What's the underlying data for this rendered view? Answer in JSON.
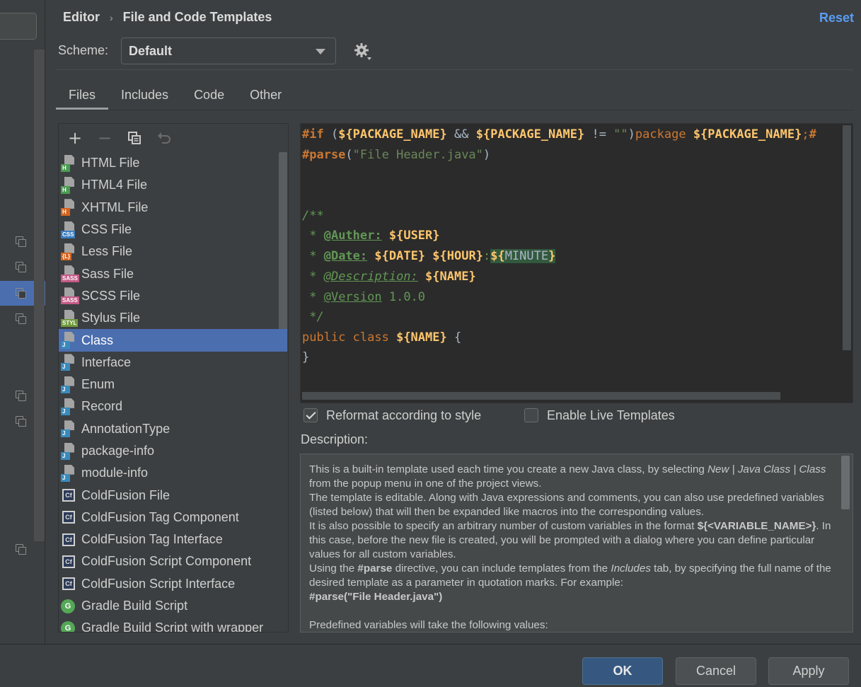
{
  "header": {
    "breadcrumb_parent": "Editor",
    "breadcrumb_separator": "›",
    "breadcrumb_current": "File and Code Templates",
    "reset_label": "Reset"
  },
  "scheme": {
    "label": "Scheme:",
    "value": "Default"
  },
  "tabs": [
    {
      "label": "Files",
      "active": true
    },
    {
      "label": "Includes",
      "active": false
    },
    {
      "label": "Code",
      "active": false
    },
    {
      "label": "Other",
      "active": false
    }
  ],
  "toolbar": {
    "add": "+",
    "remove": "−",
    "copy_icon": "copy-icon",
    "reset_icon": "undo-icon"
  },
  "templates": [
    {
      "label": "HTML File",
      "icon": "H",
      "color": "#4a9c52"
    },
    {
      "label": "HTML4 File",
      "icon": "H",
      "color": "#4a9c52"
    },
    {
      "label": "XHTML File",
      "icon": "H",
      "color": "#d6641f"
    },
    {
      "label": "CSS File",
      "icon": "CSS",
      "color": "#3b7dc0"
    },
    {
      "label": "Less File",
      "icon": "{L}",
      "color": "#d6641f"
    },
    {
      "label": "Sass File",
      "icon": "SASS",
      "color": "#c45a86"
    },
    {
      "label": "SCSS File",
      "icon": "SASS",
      "color": "#c45a86"
    },
    {
      "label": "Stylus File",
      "icon": "STYL",
      "color": "#6f9b3b"
    },
    {
      "label": "Class",
      "icon": "J",
      "color": "#3a8bbd",
      "selected": true
    },
    {
      "label": "Interface",
      "icon": "J",
      "color": "#3a8bbd"
    },
    {
      "label": "Enum",
      "icon": "J",
      "color": "#3a8bbd"
    },
    {
      "label": "Record",
      "icon": "J",
      "color": "#3a8bbd"
    },
    {
      "label": "AnnotationType",
      "icon": "J",
      "color": "#3a8bbd"
    },
    {
      "label": "package-info",
      "icon": "J",
      "color": "#3a8bbd"
    },
    {
      "label": "module-info",
      "icon": "J",
      "color": "#3a8bbd"
    },
    {
      "label": "ColdFusion File",
      "icon": "Cf",
      "color": "#2d3b57"
    },
    {
      "label": "ColdFusion Tag Component",
      "icon": "Cf",
      "color": "#2d3b57"
    },
    {
      "label": "ColdFusion Tag Interface",
      "icon": "Cf",
      "color": "#2d3b57"
    },
    {
      "label": "ColdFusion Script Component",
      "icon": "Cf",
      "color": "#2d3b57"
    },
    {
      "label": "ColdFusion Script Interface",
      "icon": "Cf",
      "color": "#2d3b57"
    },
    {
      "label": "Gradle Build Script",
      "icon": "G",
      "color": "#54a857"
    },
    {
      "label": "Gradle Build Script with wrapper",
      "icon": "G",
      "color": "#54a857"
    }
  ],
  "code": {
    "l1_if": "#if",
    "l1_a": " (",
    "l1_v1": "${PACKAGE_NAME}",
    "l1_b": " && ",
    "l1_v2": "${PACKAGE_NAME}",
    "l1_c": " != ",
    "l1_str": "\"\"",
    "l1_d": ")",
    "l1_pkg": "package",
    "l1_e": " ",
    "l1_v3": "${PACKAGE_NAME}",
    "l1_f": ";",
    "l1_g": "#",
    "l2_parse": "#parse",
    "l2_a": "(",
    "l2_str": "\"File Header.java\"",
    "l2_b": ")",
    "l5": "/**",
    "l6_star": " * ",
    "l6_tag": "@Auther:",
    "l6_sp": " ",
    "l6_var": "${USER}",
    "l7_star": " * ",
    "l7_tag": "@Date:",
    "l7_sp": " ",
    "l7_v1": "${DATE}",
    "l7_sp2": " ",
    "l7_v2": "${HOUR}",
    "l7_colon": ":",
    "l7_v3a": "${",
    "l7_v3b": "MINUTE",
    "l7_v3c": "}",
    "l8_star": " * ",
    "l8_tag": "@Description:",
    "l8_sp": " ",
    "l8_var": "${NAME}",
    "l9_star": " * ",
    "l9_tag": "@Version",
    "l9_rest": " 1.0.0",
    "l10": " */",
    "l11_kw": "public class",
    "l11_sp": " ",
    "l11_var": "${NAME}",
    "l11_rest": " {",
    "l12": "}"
  },
  "options": {
    "reformat_label": "Reformat according to style",
    "reformat_checked": true,
    "live_templates_label": "Enable Live Templates",
    "live_templates_checked": false
  },
  "description": {
    "label": "Description:",
    "p1_a": "This is a built-in template used each time you create a new Java class, by selecting ",
    "p1_i1": "New | Java Class | Class",
    "p1_b": " from the popup menu in one of the project views.",
    "p2": "The template is editable. Along with Java expressions and comments, you can also use predefined variables (listed below) that will then be expanded like macros into the corresponding values.",
    "p3_a": "It is also possible to specify an arbitrary number of custom variables in the format ",
    "p3_b": "${<VARIABLE_NAME>}",
    "p3_c": ". In this case, before the new file is created, you will be prompted with a dialog where you can define particular values for all custom variables.",
    "p4_a": "Using the ",
    "p4_b": "#parse",
    "p4_c": " directive, you can include templates from the ",
    "p4_i": "Includes",
    "p4_d": " tab, by specifying the full name of the desired template as a parameter in quotation marks. For example:",
    "p5": "#parse(\"File Header.java\")",
    "p6": "Predefined variables will take the following values:"
  },
  "footer": {
    "ok": "OK",
    "cancel": "Cancel",
    "apply": "Apply"
  }
}
